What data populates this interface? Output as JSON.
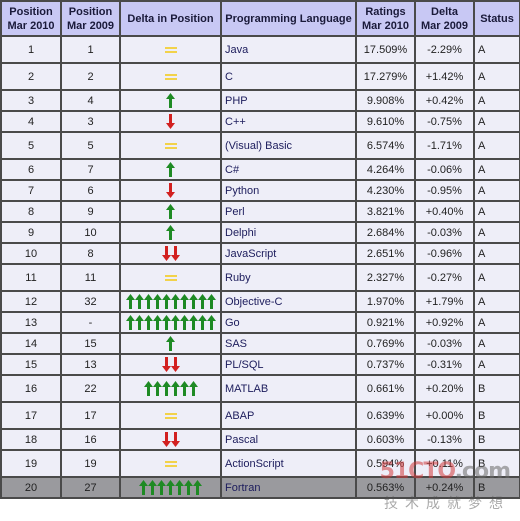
{
  "colors": {
    "header_bg": "#c8c8f4",
    "row_bg": "#eeeef8",
    "highlight_bg": "#9a9a9e",
    "border": "#4a4a4a",
    "arrow_up": "#1e8a24",
    "arrow_down": "#d22020",
    "equal": "#f2d24a",
    "language_text": "#1c1c5c"
  },
  "table": {
    "headers": {
      "pos2010": [
        "Position",
        "Mar 2010"
      ],
      "pos2009": [
        "Position",
        "Mar 2009"
      ],
      "delta_position": "Delta in Position",
      "language": "Programming Language",
      "ratings": [
        "Ratings",
        "Mar 2010"
      ],
      "delta": [
        "Delta",
        "Mar 2009"
      ],
      "status": "Status"
    },
    "rows": [
      {
        "pos2010": "1",
        "pos2009": "1",
        "change": "equal",
        "count": 1,
        "language": "Java",
        "rating": "17.509%",
        "delta": "-2.29%",
        "status": "A"
      },
      {
        "pos2010": "2",
        "pos2009": "2",
        "change": "equal",
        "count": 1,
        "language": "C",
        "rating": "17.279%",
        "delta": "+1.42%",
        "status": "A"
      },
      {
        "pos2010": "3",
        "pos2009": "4",
        "change": "up",
        "count": 1,
        "language": "PHP",
        "rating": "9.908%",
        "delta": "+0.42%",
        "status": "A"
      },
      {
        "pos2010": "4",
        "pos2009": "3",
        "change": "down",
        "count": 1,
        "language": "C++",
        "rating": "9.610%",
        "delta": "-0.75%",
        "status": "A"
      },
      {
        "pos2010": "5",
        "pos2009": "5",
        "change": "equal",
        "count": 1,
        "language": "(Visual) Basic",
        "rating": "6.574%",
        "delta": "-1.71%",
        "status": "A"
      },
      {
        "pos2010": "6",
        "pos2009": "7",
        "change": "up",
        "count": 1,
        "language": "C#",
        "rating": "4.264%",
        "delta": "-0.06%",
        "status": "A"
      },
      {
        "pos2010": "7",
        "pos2009": "6",
        "change": "down",
        "count": 1,
        "language": "Python",
        "rating": "4.230%",
        "delta": "-0.95%",
        "status": "A"
      },
      {
        "pos2010": "8",
        "pos2009": "9",
        "change": "up",
        "count": 1,
        "language": "Perl",
        "rating": "3.821%",
        "delta": "+0.40%",
        "status": "A"
      },
      {
        "pos2010": "9",
        "pos2009": "10",
        "change": "up",
        "count": 1,
        "language": "Delphi",
        "rating": "2.684%",
        "delta": "-0.03%",
        "status": "A"
      },
      {
        "pos2010": "10",
        "pos2009": "8",
        "change": "down",
        "count": 2,
        "language": "JavaScript",
        "rating": "2.651%",
        "delta": "-0.96%",
        "status": "A"
      },
      {
        "pos2010": "11",
        "pos2009": "11",
        "change": "equal",
        "count": 1,
        "language": "Ruby",
        "rating": "2.327%",
        "delta": "-0.27%",
        "status": "A"
      },
      {
        "pos2010": "12",
        "pos2009": "32",
        "change": "up",
        "count": 10,
        "language": "Objective-C",
        "rating": "1.970%",
        "delta": "+1.79%",
        "status": "A"
      },
      {
        "pos2010": "13",
        "pos2009": "-",
        "change": "up",
        "count": 10,
        "language": "Go",
        "rating": "0.921%",
        "delta": "+0.92%",
        "status": "A"
      },
      {
        "pos2010": "14",
        "pos2009": "15",
        "change": "up",
        "count": 1,
        "language": "SAS",
        "rating": "0.769%",
        "delta": "-0.03%",
        "status": "A"
      },
      {
        "pos2010": "15",
        "pos2009": "13",
        "change": "down",
        "count": 2,
        "language": "PL/SQL",
        "rating": "0.737%",
        "delta": "-0.31%",
        "status": "A"
      },
      {
        "pos2010": "16",
        "pos2009": "22",
        "change": "up",
        "count": 6,
        "language": "MATLAB",
        "rating": "0.661%",
        "delta": "+0.20%",
        "status": "B"
      },
      {
        "pos2010": "17",
        "pos2009": "17",
        "change": "equal",
        "count": 1,
        "language": "ABAP",
        "rating": "0.639%",
        "delta": "+0.00%",
        "status": "B"
      },
      {
        "pos2010": "18",
        "pos2009": "16",
        "change": "down",
        "count": 2,
        "language": "Pascal",
        "rating": "0.603%",
        "delta": "-0.13%",
        "status": "B"
      },
      {
        "pos2010": "19",
        "pos2009": "19",
        "change": "equal",
        "count": 1,
        "language": "ActionScript",
        "rating": "0.594%",
        "delta": "+0.11%",
        "status": "B"
      },
      {
        "pos2010": "20",
        "pos2009": "27",
        "change": "up",
        "count": 7,
        "language": "Fortran",
        "rating": "0.563%",
        "delta": "+0.24%",
        "status": "B",
        "highlight": true
      }
    ]
  },
  "watermark": {
    "brand_red": "51CTO",
    "brand_gray": ".com",
    "tagline": "技术成就梦想"
  }
}
